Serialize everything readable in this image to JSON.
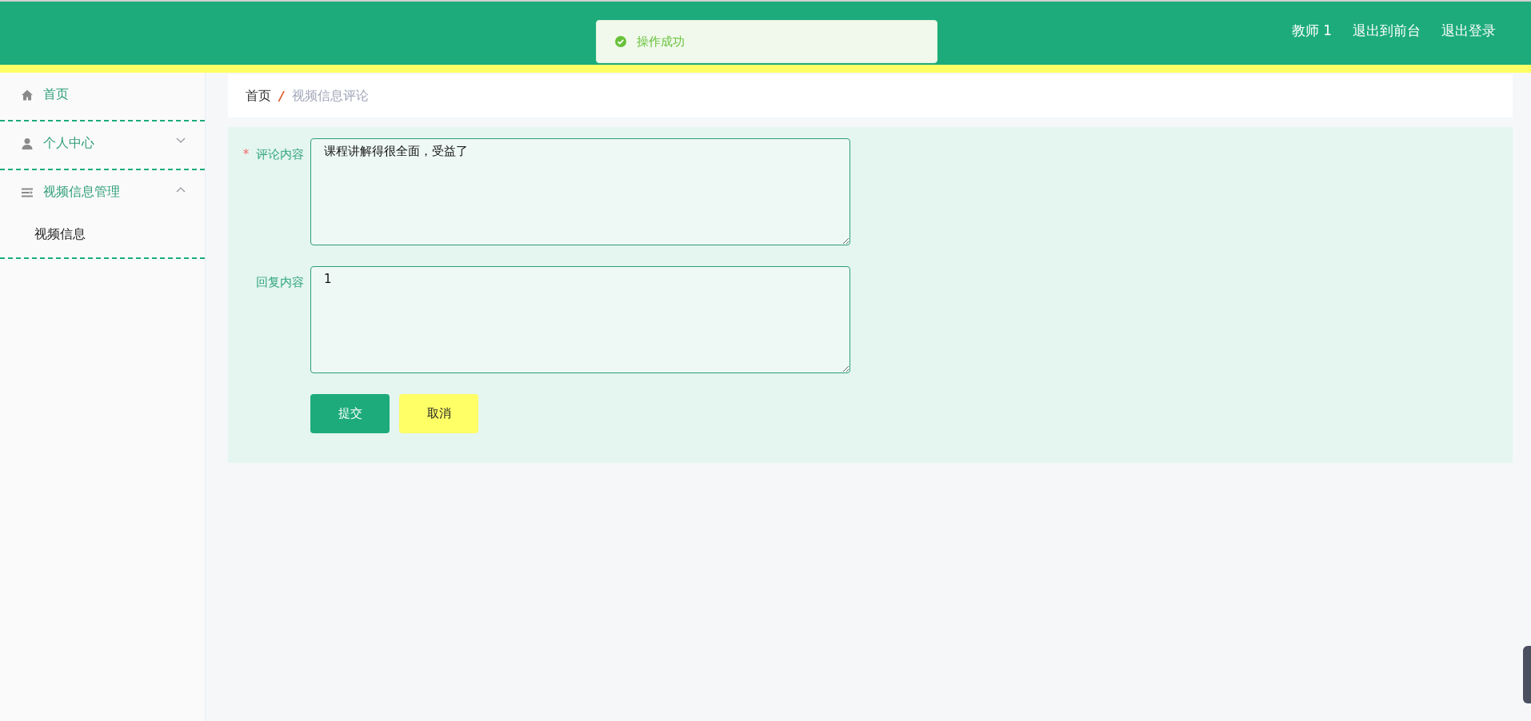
{
  "toast": {
    "kind": "success",
    "message": "操作成功"
  },
  "header": {
    "links": [
      "教师 1",
      "退出到前台",
      "退出登录"
    ]
  },
  "sidebar": {
    "items": [
      {
        "label": "首页"
      },
      {
        "label": "个人中心",
        "expanded": false
      },
      {
        "label": "视频信息管理",
        "expanded": true,
        "children": [
          {
            "label": "视频信息"
          }
        ]
      }
    ]
  },
  "breadcrumb": {
    "items": [
      "首页",
      "视频信息评论"
    ],
    "separator": "/"
  },
  "form": {
    "required_mark": "*",
    "fields": [
      {
        "label": "评论内容",
        "required": true,
        "value": "课程讲解得很全面，受益了"
      },
      {
        "label": "回复内容",
        "required": false,
        "value": "1"
      }
    ],
    "buttons": [
      {
        "label": "提交",
        "kind": "primary"
      },
      {
        "label": "取消",
        "kind": "secondary"
      }
    ]
  }
}
